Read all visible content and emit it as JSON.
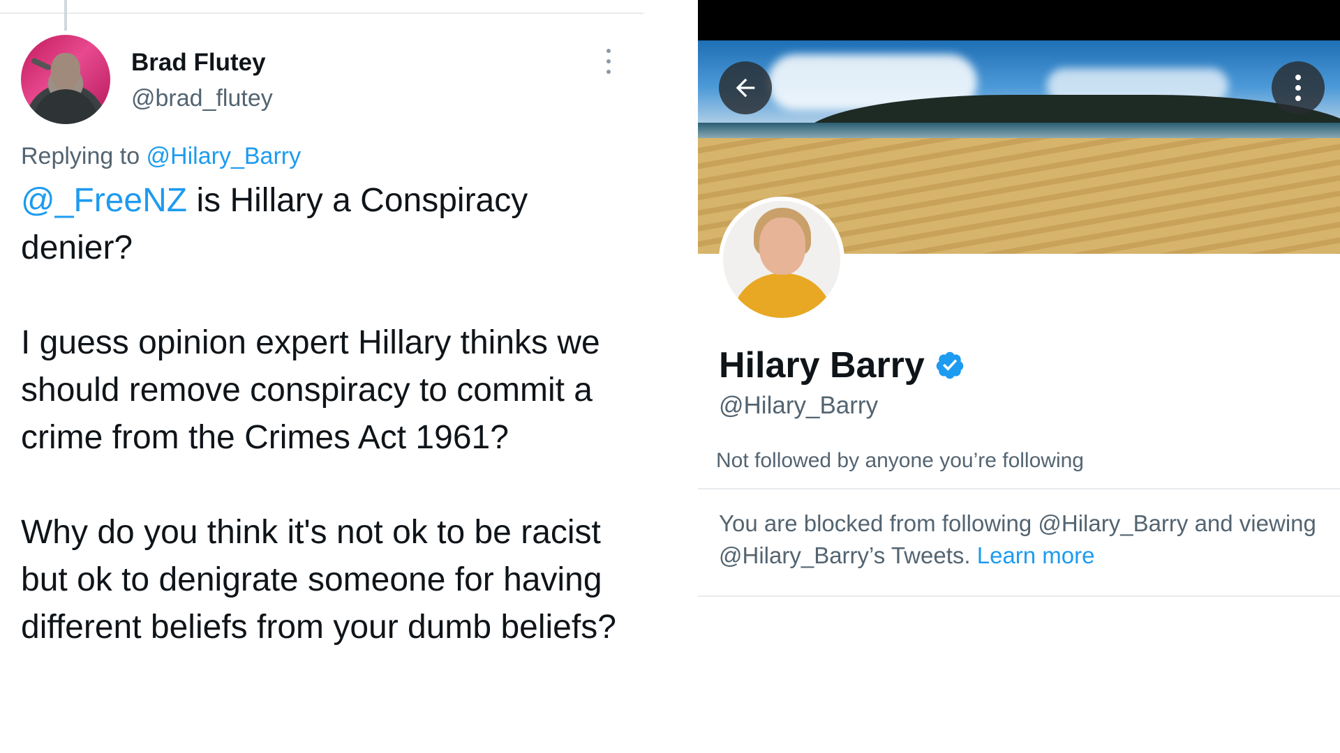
{
  "tweet": {
    "author_name": "Brad Flutey",
    "author_handle": "@brad_flutey",
    "replying_prefix": "Replying to ",
    "replying_to": "@Hilary_Barry",
    "mention": "@_FreeNZ",
    "para1_rest": " is Hillary a Conspiracy denier?",
    "para2": "I guess opinion expert Hillary thinks we should remove conspiracy to commit a crime from the Crimes Act 1961?",
    "para3": "Why do you think it's not ok to be racist but ok to denigrate someone for having different beliefs from your dumb beliefs?"
  },
  "profile": {
    "display_name": "Hilary Barry",
    "handle": "@Hilary_Barry",
    "followed_note": "Not followed by anyone you’re following",
    "blocked_text": "You are blocked from following @Hilary_Barry and viewing @Hilary_Barry’s Tweets. ",
    "learn_more": "Learn more"
  },
  "icons": {
    "back": "arrow-left-icon",
    "menu": "more-vertical-icon",
    "verified": "verified-badge-icon",
    "tweet_menu": "more-vertical-icon"
  },
  "colors": {
    "link": "#1d9bf0",
    "secondary_text": "#536471",
    "primary_text": "#0f1419"
  }
}
